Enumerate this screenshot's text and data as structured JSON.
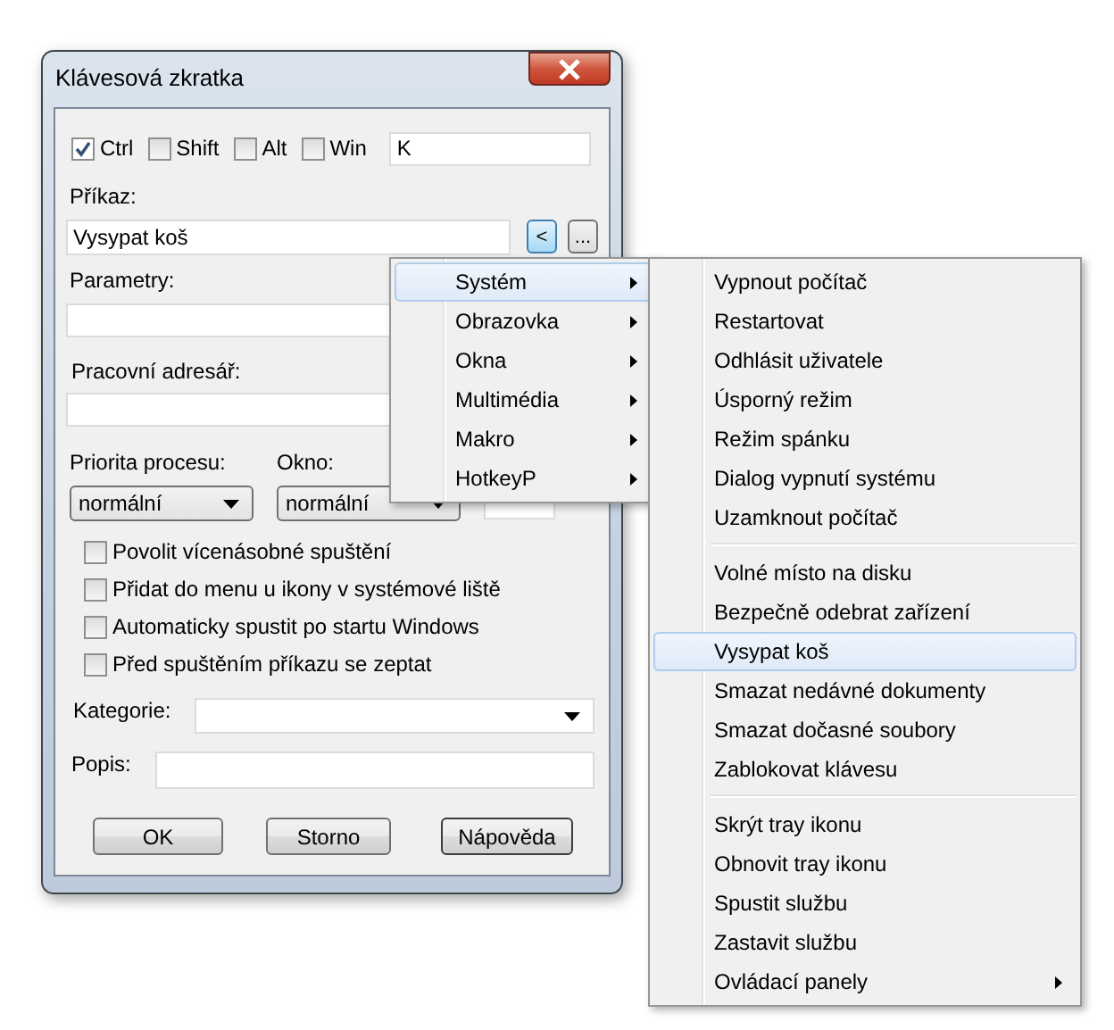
{
  "window": {
    "title": "Klávesová zkratka"
  },
  "modifiers": [
    {
      "label": "Ctrl",
      "checked": true
    },
    {
      "label": "Shift",
      "checked": false
    },
    {
      "label": "Alt",
      "checked": false
    },
    {
      "label": "Win",
      "checked": false
    }
  ],
  "key": {
    "value": "K"
  },
  "command": {
    "label": "Příkaz:",
    "value": "Vysypat koš",
    "buttons": [
      {
        "label": "<",
        "active": true
      },
      {
        "label": "...",
        "active": false
      }
    ]
  },
  "parameters": {
    "label": "Parametry:"
  },
  "working_dir": {
    "label": "Pracovní adresář:"
  },
  "priority": {
    "label": "Priorita procesu:",
    "value": "normální"
  },
  "window_mode": {
    "label": "Okno:",
    "value": "normální"
  },
  "options": [
    {
      "label": "Povolit vícenásobné spuštění",
      "checked": false
    },
    {
      "label": "Přidat do menu u ikony v systémové liště",
      "checked": false
    },
    {
      "label": "Automaticky spustit po startu Windows",
      "checked": false
    },
    {
      "label": "Před spuštěním příkazu se zeptat",
      "checked": false
    }
  ],
  "category": {
    "label": "Kategorie:"
  },
  "description": {
    "label": "Popis:"
  },
  "dialog_buttons": [
    {
      "label": "OK",
      "default": false
    },
    {
      "label": "Storno",
      "default": false
    },
    {
      "label": "Nápověda",
      "default": true
    }
  ],
  "menu": {
    "items": [
      {
        "label": "Systém",
        "selected": true,
        "submenu": true
      },
      {
        "label": "Obrazovka",
        "selected": false,
        "submenu": true
      },
      {
        "label": "Okna",
        "selected": false,
        "submenu": true
      },
      {
        "label": "Multimédia",
        "selected": false,
        "submenu": true
      },
      {
        "label": "Makro",
        "selected": false,
        "submenu": true
      },
      {
        "label": "HotkeyP",
        "selected": false,
        "submenu": true
      }
    ]
  },
  "submenu": {
    "groups": [
      {
        "items": [
          {
            "label": "Vypnout počítač",
            "selected": false,
            "submenu": false
          },
          {
            "label": "Restartovat",
            "selected": false,
            "submenu": false
          },
          {
            "label": "Odhlásit uživatele",
            "selected": false,
            "submenu": false
          },
          {
            "label": "Úsporný režim",
            "selected": false,
            "submenu": false
          },
          {
            "label": "Režim spánku",
            "selected": false,
            "submenu": false
          },
          {
            "label": "Dialog vypnutí systému",
            "selected": false,
            "submenu": false
          },
          {
            "label": "Uzamknout počítač",
            "selected": false,
            "submenu": false
          }
        ]
      },
      {
        "items": [
          {
            "label": "Volné místo na disku",
            "selected": false,
            "submenu": false
          },
          {
            "label": "Bezpečně odebrat zařízení",
            "selected": false,
            "submenu": false
          },
          {
            "label": "Vysypat koš",
            "selected": true,
            "submenu": false
          },
          {
            "label": "Smazat nedávné dokumenty",
            "selected": false,
            "submenu": false
          },
          {
            "label": "Smazat dočasné soubory",
            "selected": false,
            "submenu": false
          },
          {
            "label": "Zablokovat klávesu",
            "selected": false,
            "submenu": false
          }
        ]
      },
      {
        "items": [
          {
            "label": "Skrýt tray ikonu",
            "selected": false,
            "submenu": false
          },
          {
            "label": "Obnovit tray ikonu",
            "selected": false,
            "submenu": false
          },
          {
            "label": "Spustit službu",
            "selected": false,
            "submenu": false
          },
          {
            "label": "Zastavit službu",
            "selected": false,
            "submenu": false
          },
          {
            "label": "Ovládací panely",
            "selected": false,
            "submenu": true
          }
        ]
      }
    ]
  }
}
